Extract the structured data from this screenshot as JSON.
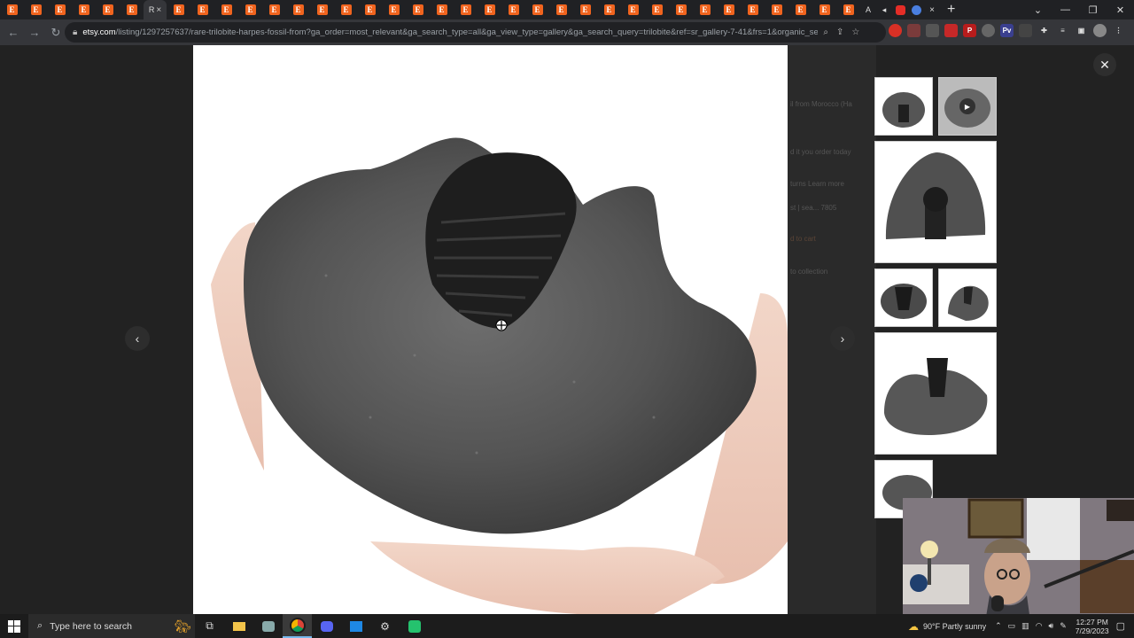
{
  "browser": {
    "active_tab_label": "R",
    "tab_close_glyph": "×",
    "new_tab_glyph": "+",
    "url_domain": "etsy.com",
    "url_path": "/listing/1297257637/rare-trilobite-harpes-fossil-from?ga_order=most_relevant&ga_search_type=all&ga_view_type=gallery&ga_search_query=trilobite&ref=sr_gallery-7-41&frs=1&organic_sea...",
    "favicon_letter": "E"
  },
  "page_background_text": {
    "title_fragment": "il from Morocco (Ha",
    "line2": "d it you order today",
    "line3": "turns  Learn more",
    "line4": "st  |  sea... 7805",
    "add_to_cart": "d to cart",
    "add_to_collection": "to collection"
  },
  "viewer": {
    "prev_label": "‹",
    "next_label": "›",
    "close_label": "✕"
  },
  "taskbar": {
    "search_placeholder": "Type here to search",
    "weather": "90°F  Partly sunny",
    "time": "12:27 PM",
    "date": "7/29/2023"
  },
  "colors": {
    "etsy_orange": "#f1641e",
    "overlay_bg": "#222222",
    "taskbar_bg": "#1c1c1c"
  }
}
